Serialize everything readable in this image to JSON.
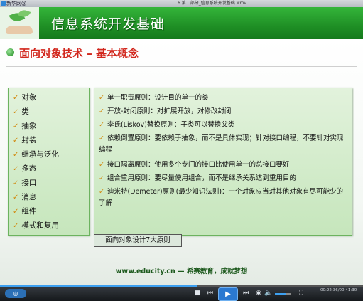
{
  "window": {
    "app_name": "新华网@",
    "title": "6.第二部分_信息系统开发基础.wmv"
  },
  "header": {
    "title": "信息系统开发基础"
  },
  "section": {
    "title": "面向对象技术 – 基本概念"
  },
  "concepts": [
    "对象",
    "类",
    "抽象",
    "封装",
    "继承与泛化",
    "多态",
    "接口",
    "消息",
    "组件",
    "模式和复用"
  ],
  "principles": [
    "单一职责原则：设计目的单一的类",
    "开放-封闭原则：对扩展开放，对修改封闭",
    "李氏(Liskov)替换原则：子类可以替换父类",
    "依赖倒置原则：要依赖于抽象，而不是具体实现；针对接口编程，不要针对实现编程",
    "接口隔离原则：使用多个专门的接口比使用单一的总接口要好",
    "组合重用原则：要尽量使用组合，而不是继承关系达到重用目的",
    "迪米特(Demeter)原则(最少知识法则)：一个对象应当对其他对象有尽可能少的了解"
  ],
  "principles_tag": "面向对象设计7大原则",
  "footer": {
    "text": "www.educity.cn  —  希赛教育，成就梦想"
  },
  "player": {
    "time": "00:22:36/00:41:30",
    "progress": 0.545,
    "volume": 0.7,
    "accent": "#3da0f0",
    "icons": [
      "view-icon",
      "stop-icon",
      "prev-icon",
      "play-icon",
      "next-icon",
      "mute-icon",
      "volume-icon",
      "fullscreen-icon"
    ]
  }
}
